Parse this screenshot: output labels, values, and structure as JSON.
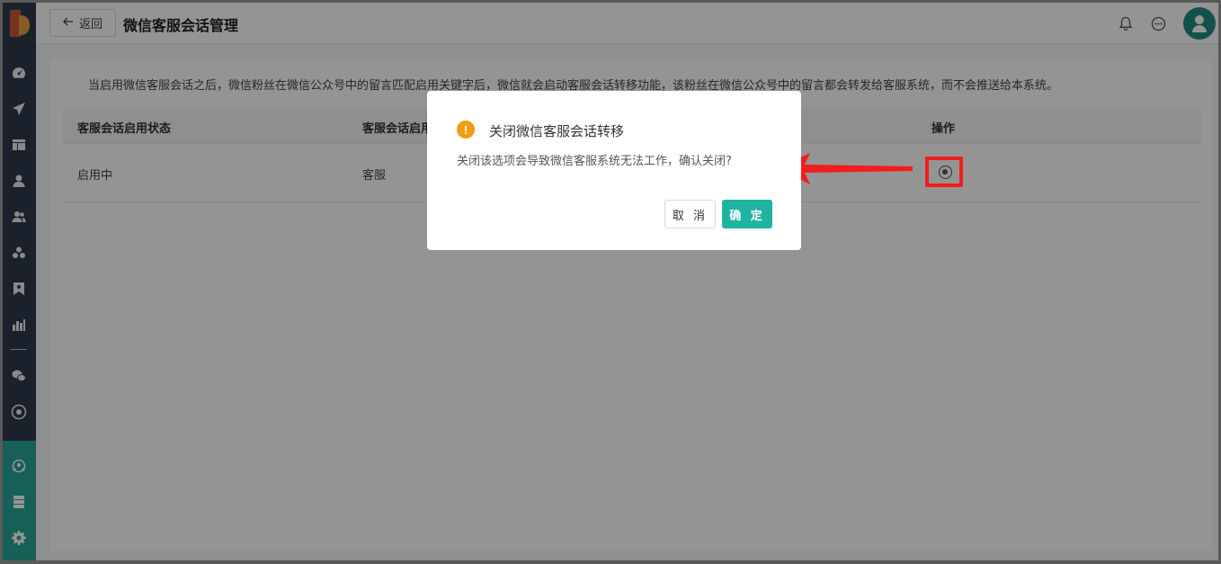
{
  "header": {
    "back_label": "返回",
    "title": "微信客服会话管理"
  },
  "sidebar": {
    "icons": [
      "dashboard-icon",
      "send-icon",
      "layout-icon",
      "user-icon",
      "users-icon",
      "group-icon",
      "bookmark-icon",
      "bar-chart-icon",
      "wechat-icon",
      "target-icon"
    ],
    "bottom_icons": [
      "network-icon",
      "server-icon",
      "settings-icon"
    ]
  },
  "main": {
    "notice": "当启用微信客服会话之后，微信粉丝在微信公众号中的留言匹配启用关键字后，微信就会启动客服会话转移功能，该粉丝在微信公众号中的留言都会转发给客服系统，而不会推送给本系统。",
    "table": {
      "headers": [
        "客服会话启用状态",
        "客服会话启用",
        "操作"
      ],
      "rows": [
        {
          "status": "启用中",
          "keyword": "客服"
        }
      ]
    }
  },
  "dialog": {
    "title": "关闭微信客服会话转移",
    "message": "关闭该选项会导致微信客服系统无法工作，确认关闭?",
    "cancel_label": "取 消",
    "ok_label": "确 定",
    "warn_symbol": "!"
  },
  "colors": {
    "sidebar": "#2f3a4b",
    "accent": "#20b3a2",
    "warning": "#f29d10",
    "annotation": "#f21c1c"
  }
}
